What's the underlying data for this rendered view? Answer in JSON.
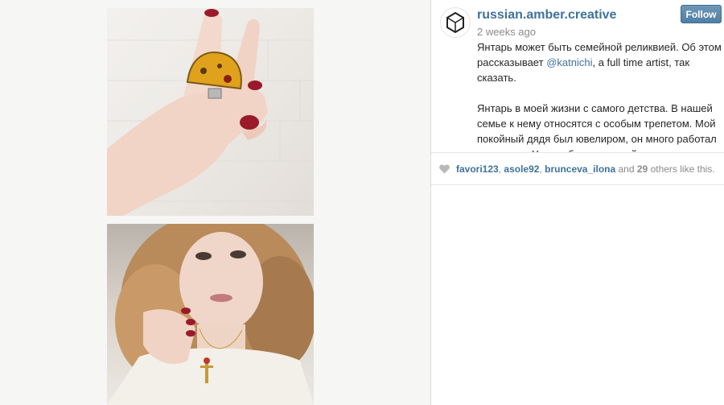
{
  "post": {
    "username": "russian.amber.creative",
    "timestamp": "2 weeks ago",
    "follow_label": "Follow",
    "caption": {
      "line1_pre": "Янтарь может быть семейной реликвией. Об этом рассказывает ",
      "mention": "@katnichi",
      "line1_post": ", a full time artist, так сказать.",
      "para2": "Янтарь в моей жизни с самого детства. В нашей семье к нему относятся с особым трепетом. Мой покойный дядя был ювелиром, он много работал с янтарем. У дяди был отличный вкус, и он делал действительно"
    }
  },
  "likes": {
    "users": [
      "favori123",
      "asole92",
      "brunceva_ilona"
    ],
    "separator": ",",
    "and_text": "and",
    "count": "29",
    "suffix": "others like this."
  },
  "icons": {
    "avatar": "hexagon-logo-icon",
    "like": "heart-icon"
  },
  "colors": {
    "link": "#3f729b",
    "follow_button": "#517fa4",
    "muted_text": "#8a8a8a",
    "ring_nail": "#9a1a2a",
    "amber": "#e0a21c"
  }
}
